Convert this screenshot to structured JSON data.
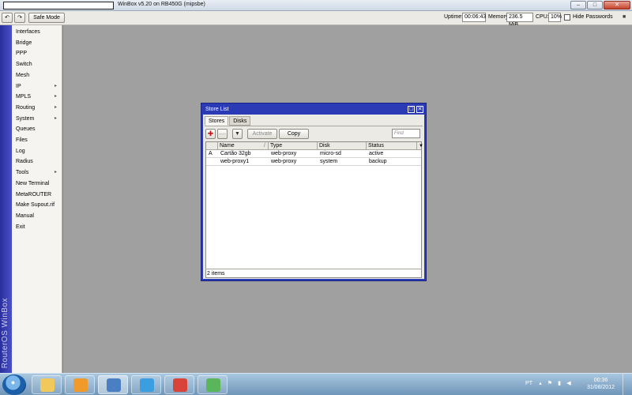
{
  "window": {
    "title": "WinBox v5.20 on RB450G (mipsbe)",
    "min_glyph": "–",
    "max_glyph": "□",
    "close_glyph": "✕"
  },
  "toolbar": {
    "undo_glyph": "↶",
    "redo_glyph": "↷",
    "safe_mode": "Safe Mode",
    "uptime_label": "Uptime:",
    "uptime_value": "00:06:43",
    "memory_label": "Memory:",
    "memory_value": "236.5 MiB",
    "cpu_label": "CPU:",
    "cpu_value": "10%",
    "hide_passwords": "Hide Passwords",
    "lock_glyph": "■"
  },
  "sidebar": {
    "vertical_label": "RouterOS WinBox",
    "items": [
      {
        "label": "Interfaces",
        "arrow": ""
      },
      {
        "label": "Bridge",
        "arrow": ""
      },
      {
        "label": "PPP",
        "arrow": ""
      },
      {
        "label": "Switch",
        "arrow": ""
      },
      {
        "label": "Mesh",
        "arrow": ""
      },
      {
        "label": "IP",
        "arrow": "▸"
      },
      {
        "label": "MPLS",
        "arrow": "▸"
      },
      {
        "label": "Routing",
        "arrow": "▸"
      },
      {
        "label": "System",
        "arrow": "▸"
      },
      {
        "label": "Queues",
        "arrow": ""
      },
      {
        "label": "Files",
        "arrow": ""
      },
      {
        "label": "Log",
        "arrow": ""
      },
      {
        "label": "Radius",
        "arrow": ""
      },
      {
        "label": "Tools",
        "arrow": "▸"
      },
      {
        "label": "New Terminal",
        "arrow": ""
      },
      {
        "label": "MetaROUTER",
        "arrow": ""
      },
      {
        "label": "Make Supout.rif",
        "arrow": ""
      },
      {
        "label": "Manual",
        "arrow": ""
      },
      {
        "label": "Exit",
        "arrow": ""
      }
    ]
  },
  "dialog": {
    "title": "Store List",
    "restore_glyph": "□",
    "close_glyph": "✕",
    "tabs": [
      "Stores",
      "Disks"
    ],
    "add_glyph": "✚",
    "remove_glyph": "—",
    "filter_glyph": "▼",
    "activate_label": "Activate",
    "copy_label": "Copy",
    "find_placeholder": "Find",
    "columns": [
      "Name",
      "Type",
      "Disk",
      "Status"
    ],
    "sort_glyph": "/",
    "menu_glyph": "▼",
    "rows": [
      {
        "flag": "A",
        "name": "Cartão 32gb",
        "type": "web-proxy",
        "disk": "micro-sd",
        "status": "active"
      },
      {
        "flag": "",
        "name": "web-proxy1",
        "type": "web-proxy",
        "disk": "system",
        "status": "backup"
      }
    ],
    "status": "2 items"
  },
  "taskbar": {
    "language": "PT",
    "time": "00:36",
    "date": "31/08/2012",
    "apps": [
      {
        "name": "explorer",
        "color": "#f0c95a",
        "active": false
      },
      {
        "name": "media-player",
        "color": "#f09a2a",
        "active": false
      },
      {
        "name": "winbox",
        "color": "#4a7fc4",
        "active": true
      },
      {
        "name": "internet-explorer",
        "color": "#3a9ee0",
        "active": false
      },
      {
        "name": "chrome",
        "color": "#d9443a",
        "active": false
      },
      {
        "name": "messenger",
        "color": "#5bb55a",
        "active": false
      }
    ]
  }
}
